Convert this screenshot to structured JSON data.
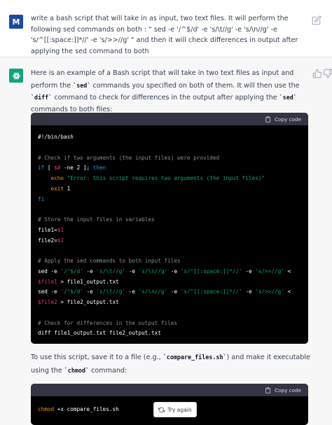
{
  "user": {
    "avatar_letter": "M",
    "message": "write a bash script that will take in as input, two text files. It will perform the following sed commands on both : \" sed -e '/^$/d' -e 's/\\t//g' -e 's/\\n//g' -e 's/^[[:space:]]*//' -e 's/>>//g' \" and then it will check differences in output after applying the sed command to both"
  },
  "assistant": {
    "intro": {
      "p1": "Here is an example of a Bash script that will take in two text files as input and perform the ",
      "code1": "`sed`",
      "p2": " commands you specified on both of them. It will then use the ",
      "code2": "`diff`",
      "p3": " command to check for differences in the output after applying the ",
      "code3": "`sed`",
      "p4": " commands to both files:"
    },
    "copy_label": "Copy code",
    "code": {
      "shebang": "#!/bin/bash",
      "comment1": "# Check if two arguments (the input files) were provided",
      "if_kw": "if",
      "if_open": " [ ",
      "if_var": "$#",
      "if_rest": " -ne 2 ]; ",
      "then_kw": "then",
      "echo_kw": "echo",
      "echo_str": "\"Error: this script requires two arguments (the input files)\"",
      "exit_kw": "exit",
      "exit_num": "1",
      "fi_kw": "fi",
      "comment2": "# Store the input files in variables",
      "file1_name": "file1=",
      "file1_val": "$1",
      "file2_name": "file2=",
      "file2_val": "$2",
      "comment3": "# Apply the sed commands to both input files",
      "sed_cmd": "sed",
      "sed_args": "'/^$/d'",
      "sed_args2": "'s/\\t//g'",
      "sed_args3": "'s/\\n//g'",
      "sed_args4": "'s/^[[:space:]]*//'",
      "sed_args5": "'s/>>//g'",
      "sed_flag": "-e",
      "redirect_in": "<",
      "var_file1": "$file1",
      "out1": "> file1_output.txt",
      "var_file2": "$file2",
      "out2": "> file2_output.txt",
      "comment4": "# Check for differences in the output files",
      "diff_line": "diff file1_output.txt file2_output.txt"
    },
    "outro": {
      "p1": "To use this script, save it to a file (e.g., ",
      "code1": "`compare_files.sh`",
      "p2": ") and make it executable using the ",
      "code2": "`chmod`",
      "p3": " command:"
    },
    "code2": {
      "cmd": "chmod",
      "args": " +x compare_files.sh"
    },
    "try_again": "Try again"
  }
}
